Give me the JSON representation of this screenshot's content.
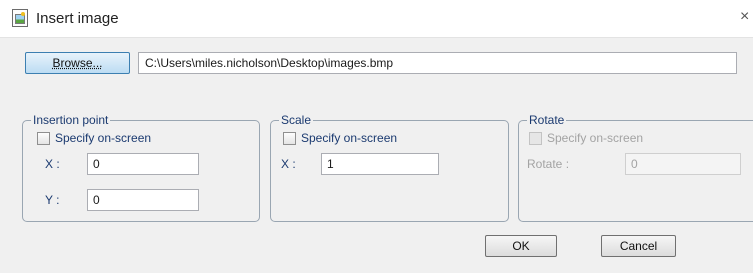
{
  "window": {
    "title": "Insert image",
    "close_glyph": "×"
  },
  "browse": {
    "button_label": "Browse...",
    "path_value": "C:\\Users\\miles.nicholson\\Desktop\\images.bmp"
  },
  "insertion_point": {
    "label": "Insertion point",
    "specify_label": "Specify on-screen",
    "specify_checked": false,
    "x_label": "X :",
    "x_value": "0",
    "y_label": "Y :",
    "y_value": "0"
  },
  "scale": {
    "label": "Scale",
    "specify_label": "Specify on-screen",
    "specify_checked": false,
    "x_label": "X :",
    "x_value": "1"
  },
  "rotate": {
    "label": "Rotate",
    "specify_label": "Specify on-screen",
    "specify_checked": false,
    "enabled": false,
    "rotate_label": "Rotate :",
    "rotate_value": "0"
  },
  "footer": {
    "ok_label": "OK",
    "cancel_label": "Cancel"
  }
}
